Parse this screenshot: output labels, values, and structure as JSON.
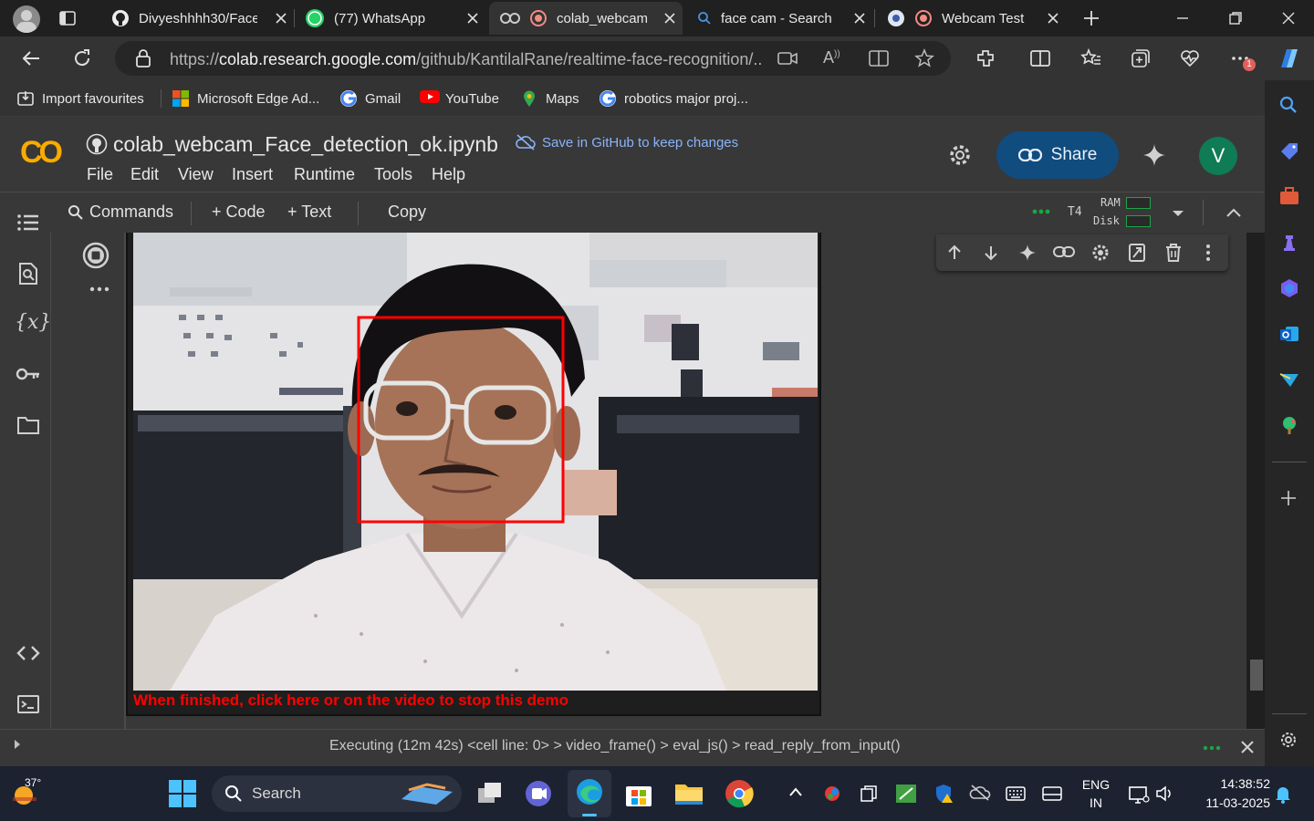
{
  "browser": {
    "tabs": [
      {
        "label": "Divyeshhhh30/Face",
        "icon": "github-icon"
      },
      {
        "label": "(77) WhatsApp",
        "icon": "whatsapp-icon",
        "badge": "77"
      },
      {
        "label": "colab_webcam",
        "icon": "colab-icon",
        "active": true
      },
      {
        "label": "face cam - Search",
        "icon": "bing-search-icon"
      },
      {
        "label": "Webcam Test",
        "icon": "record-icon"
      }
    ],
    "url_domain": "colab.research.google.com",
    "url_prefix": "https://",
    "url_path": "/github/KantilalRane/realtime-face-recognition/...",
    "extension_badge": "1",
    "favourites": [
      {
        "label": "Import favourites",
        "icon": "import-icon"
      },
      {
        "label": "Microsoft Edge Ad...",
        "icon": "microsoft-icon"
      },
      {
        "label": "Gmail",
        "icon": "google-icon"
      },
      {
        "label": "YouTube",
        "icon": "youtube-icon"
      },
      {
        "label": "Maps",
        "icon": "maps-pin-icon"
      },
      {
        "label": "robotics major proj...",
        "icon": "google-icon"
      }
    ]
  },
  "colab": {
    "logo": "CO",
    "notebook_title": "colab_webcam_Face_detection_ok.ipynb",
    "save_github": "Save in GitHub to keep changes",
    "menu": [
      "File",
      "Edit",
      "View",
      "Insert",
      "Runtime",
      "Tools",
      "Help"
    ],
    "share_label": "Share",
    "avatar_initial": "V",
    "toolbar": {
      "commands": "Commands",
      "code": "+ Code",
      "text": "+ Text",
      "copy": "Copy",
      "runtime_type": "T4",
      "ram_label": "RAM",
      "disk_label": "Disk"
    },
    "output_stop_text": "When finished, click here or on the video to stop this demo",
    "status": "Executing (12m 42s)  <cell line: 0>  >  video_frame()  >  eval_js()  >  read_reply_from_input()"
  },
  "taskbar": {
    "weather_temp": "37°",
    "search_placeholder": "Search",
    "language": "ENG",
    "region": "IN",
    "time": "14:38:52",
    "date": "11-03-2025"
  },
  "colors": {
    "accent_blue": "#8ab4f8",
    "share_bg": "#104c7e",
    "face_box": "#ff0000",
    "colab_orange": "#f9ab00",
    "status_green": "#1ea446"
  }
}
